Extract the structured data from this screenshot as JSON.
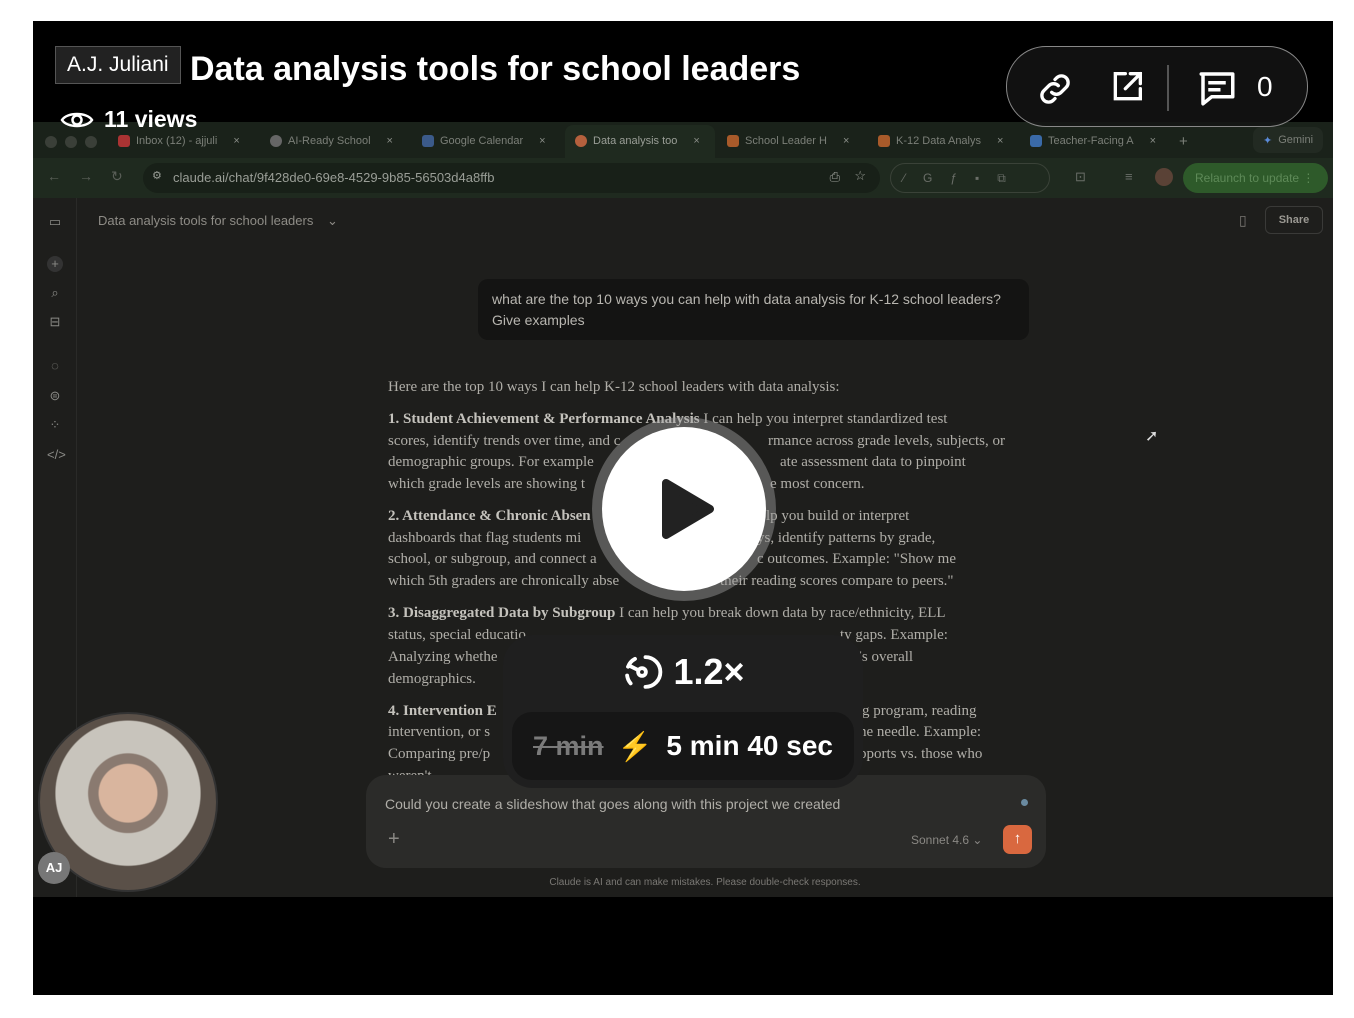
{
  "video": {
    "author": "A.J. Juliani",
    "title": "Data analysis tools for school leaders",
    "views": "11 views",
    "comment_count": "0",
    "speed": "1.2×",
    "original_duration": "7 min",
    "adjusted_duration": "5 min 40 sec"
  },
  "browser": {
    "tabs": [
      {
        "label": "Inbox (12) - ajjuli"
      },
      {
        "label": "AI-Ready School"
      },
      {
        "label": "Google Calendar"
      },
      {
        "label": "Data analysis too"
      },
      {
        "label": "School Leader H"
      },
      {
        "label": "K-12 Data Analys"
      },
      {
        "label": "Teacher-Facing A"
      }
    ],
    "new_tab": "+",
    "gemini": "Gemini",
    "close": "×",
    "url": "claude.ai/chat/9f428de0-69e8-4529-9b85-56503d4a8ffb",
    "relaunch": "Relaunch to update"
  },
  "app": {
    "chat_title": "Data analysis tools for school leaders",
    "share": "Share",
    "user_message": "what are the top 10 ways you can help with data analysis for K-12 school leaders? Give examples",
    "response_lines": [
      {
        "bold": "",
        "text": "Here are the top 10 ways I can help K-12 school leaders with data analysis:",
        "right": ""
      },
      {
        "bold": "1. Student Achievement & Performance Analysis",
        "text": " I can help you interpret standardized test",
        "right": ""
      },
      {
        "bold": "",
        "text": "scores, identify trends over time, and c",
        "right": "rmance across grade levels, subjects, or"
      },
      {
        "bold": "",
        "text": "demographic groups. For example",
        "right": "ate assessment data to pinpoint"
      },
      {
        "bold": "",
        "text": "which grade levels are showing t",
        "right": "e most concern."
      },
      {
        "bold": "2. Attendance & Chronic Absen",
        "text": "",
        "right": "lp you build or interpret"
      },
      {
        "bold": "",
        "text": "dashboards that flag students mi",
        "right": "ys, identify patterns by grade,"
      },
      {
        "bold": "",
        "text": "school, or subgroup, and connect a",
        "right": "c outcomes. Example: \"Show me"
      },
      {
        "bold": "",
        "text": "which 5th graders are chronically abse",
        "right": "their reading scores compare to peers.\""
      },
      {
        "bold": "3. Disaggregated Data by Subgroup",
        "text": " I can help you break down data by race/ethnicity, ELL",
        "right": ""
      },
      {
        "bold": "",
        "text": "status, special educatio",
        "right": "ty gaps. Example:"
      },
      {
        "bold": "",
        "text": "Analyzing whethe",
        "right": "l's overall"
      },
      {
        "bold": "",
        "text": "demographics.",
        "right": ""
      },
      {
        "bold": "4. Intervention E",
        "text": "",
        "right": "g program, reading"
      },
      {
        "bold": "",
        "text": "intervention, or s",
        "right": "he needle. Example:"
      },
      {
        "bold": "",
        "text": "Comparing pre/p",
        "right": "pports vs. those who"
      },
      {
        "bold": "",
        "text": "weren't",
        "right": ""
      }
    ],
    "input_text": "Could you create a slideshow that goes along with this project we created",
    "model": "Sonnet 4.6",
    "disclaimer": "Claude is AI and can make mistakes. Please double-check responses.",
    "avatar_initials": "AJ"
  },
  "colors": {
    "send": "#d9683f",
    "relaunch": "#2e5a2a"
  }
}
